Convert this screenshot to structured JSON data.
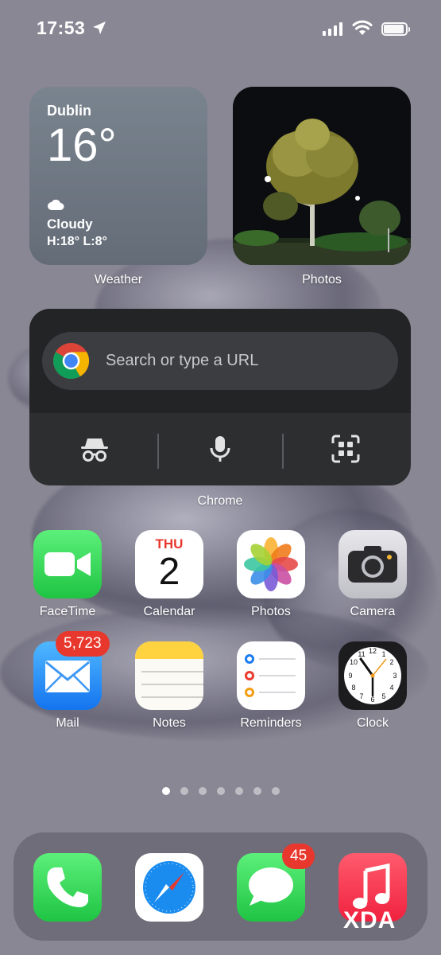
{
  "status": {
    "time": "17:53"
  },
  "weather": {
    "city": "Dublin",
    "temp": "16°",
    "condition": "Cloudy",
    "hilo": "H:18° L:8°",
    "label": "Weather"
  },
  "photos_widget": {
    "label": "Photos"
  },
  "chrome": {
    "placeholder": "Search or type a URL",
    "label": "Chrome"
  },
  "apps": [
    {
      "label": "FaceTime",
      "icon": "facetime-icon"
    },
    {
      "label": "Calendar",
      "icon": "calendar-icon",
      "day_name": "THU",
      "day_num": "2"
    },
    {
      "label": "Photos",
      "icon": "photos-icon"
    },
    {
      "label": "Camera",
      "icon": "camera-icon"
    },
    {
      "label": "Mail",
      "icon": "mail-icon",
      "badge": "5,723"
    },
    {
      "label": "Notes",
      "icon": "notes-icon"
    },
    {
      "label": "Reminders",
      "icon": "reminders-icon"
    },
    {
      "label": "Clock",
      "icon": "clock-icon"
    }
  ],
  "dock": [
    {
      "icon": "phone-icon"
    },
    {
      "icon": "safari-icon"
    },
    {
      "icon": "messages-icon",
      "badge": "45"
    },
    {
      "icon": "music-icon"
    }
  ],
  "pages": {
    "count": 7,
    "active": 1
  },
  "watermark": "XDA",
  "colors": {
    "badge": "#e8372c",
    "facetime": "#34c759",
    "mail": "#1e88f5",
    "camera": "#d9d9de"
  }
}
